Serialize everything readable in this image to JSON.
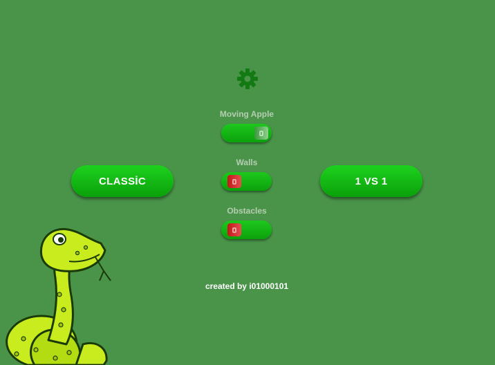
{
  "settings": {
    "icon": "gear-icon",
    "options": [
      {
        "label": "Moving Apple",
        "state": "on"
      },
      {
        "label": "Walls",
        "state": "off"
      },
      {
        "label": "Obstacles",
        "state": "off"
      }
    ]
  },
  "modes": {
    "classic_label": "CLASSİC",
    "versus_label": "1 VS 1"
  },
  "credit": "created by i01000101",
  "colors": {
    "background": "#4a944a",
    "button": "#12b812",
    "toggle_off_knob": "#d63030",
    "toggle_on_knob": "#6cbf6c",
    "snake": "#c8ec1e"
  }
}
